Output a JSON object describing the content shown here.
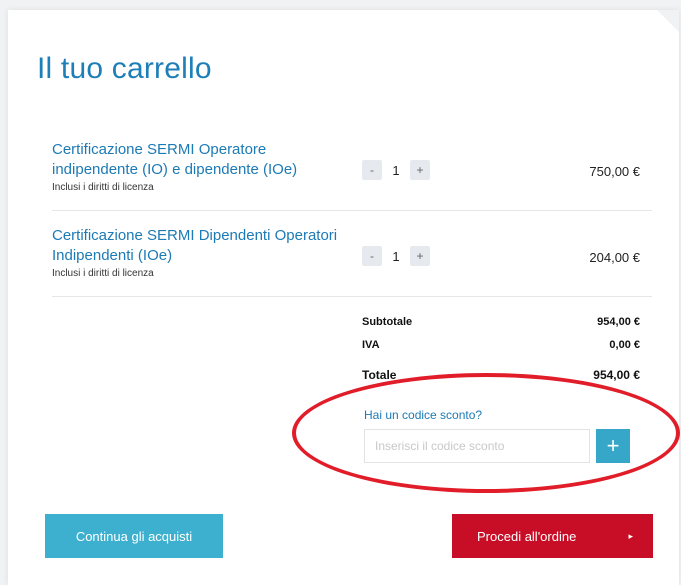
{
  "cart": {
    "title": "Il tuo carrello",
    "items": [
      {
        "name": "Certificazione SERMI Operatore indipendente (IO) e dipendente (IOe)",
        "note": "Inclusi i diritti di licenza",
        "quantity": "1",
        "price": "750,00 €",
        "minus": "-",
        "plus": "+"
      },
      {
        "name": "Certificazione SERMI Dipendenti Operatori Indipendenti (IOe)",
        "note": "Inclusi i diritti di licenza",
        "quantity": "1",
        "price": "204,00 €",
        "minus": "-",
        "plus": "+"
      }
    ],
    "summary": {
      "subtotal_label": "Subtotale",
      "subtotal_value": "954,00 €",
      "vat_label": "IVA",
      "vat_value": "0,00 €",
      "total_label": "Totale",
      "total_value": "954,00 €"
    },
    "discount": {
      "link_text": "Hai un codice sconto?",
      "placeholder": "Inserisci il codice sconto",
      "value": "",
      "add_label": "+"
    },
    "actions": {
      "continue_label": "Continua gli acquisti",
      "checkout_label": "Procedi all'ordine",
      "checkout_icon": "▸"
    },
    "annotation": {
      "color": "#e11d2a",
      "shape": "ellipse"
    },
    "colors": {
      "accent_blue": "#1c7ab5",
      "button_teal": "#3db0cf",
      "checkout_red": "#c80e26"
    }
  }
}
